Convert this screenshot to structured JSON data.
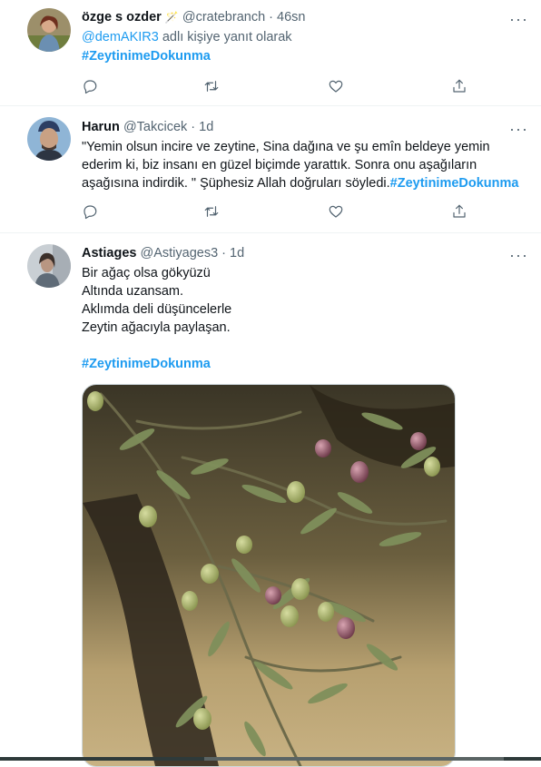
{
  "tweets": [
    {
      "name": "özge s ozder",
      "badge": "🪄",
      "handle": "@cratebranch",
      "sep": "·",
      "time": "46sn",
      "reply_mention": "@demAKIR3",
      "reply_suffix": " adlı kişiye yanıt olarak",
      "hashtag": "#ZeytinimeDokunma"
    },
    {
      "name": "Harun",
      "handle": "@Takcicek",
      "sep": "·",
      "time": "1d",
      "lines": [
        "\"Yemin olsun incire ve   zeytine, Sina dağına ve şu emîn beldeye yemin",
        "ederim ki, biz insanı en güzel biçimde yarattık. Sonra onu aşağıların"
      ],
      "line3_text": "aşağısına indirdik. \" Şüphesiz Allah doğruları söyledi.",
      "hashtag": "#ZeytinimeDokunma"
    },
    {
      "name": "Astiages",
      "handle": "@Astiyages3",
      "sep": "·",
      "time": "1d",
      "lines": [
        "Bir ağaç olsa gökyüzü",
        "Altında uzansam.",
        "Aklımda deli düşüncelerle",
        "Zeytin ağacıyla paylaşan."
      ],
      "hashtag": "#ZeytinimeDokunma"
    }
  ],
  "more_label": "···",
  "icons": {
    "reply": "reply-icon",
    "retweet": "retweet-icon",
    "like": "heart-icon",
    "share": "share-icon"
  },
  "colors": {
    "accent": "#1d9bf0",
    "muted": "#536471",
    "text": "#0f1419"
  }
}
